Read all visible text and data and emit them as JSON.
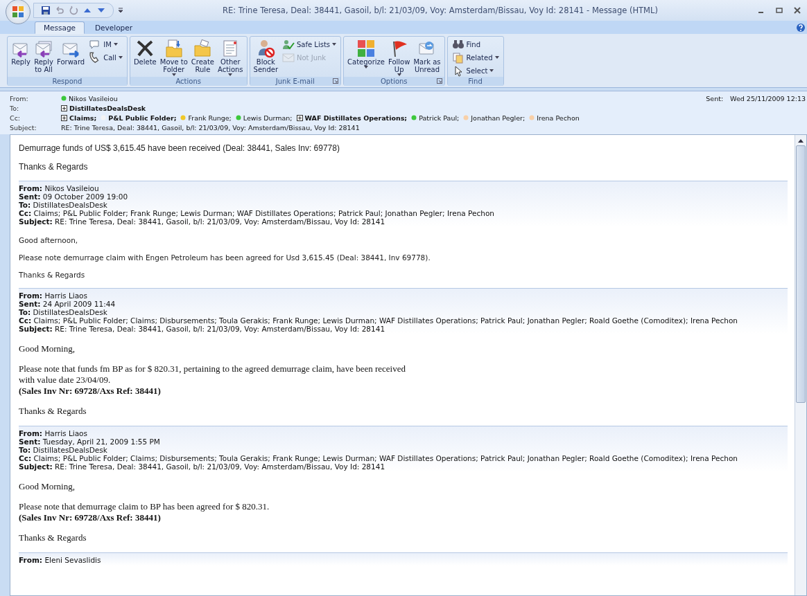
{
  "window": {
    "title": "RE: Trine Teresa, Deal: 38441, Gasoil, b/l: 21/03/09, Voy: Amsterdam/Bissau, Voy Id: 28141  - Message (HTML)"
  },
  "tabs": [
    {
      "label": "Message",
      "selected": true
    },
    {
      "label": "Developer",
      "selected": false
    }
  ],
  "ribbon": [
    {
      "label": "Respond",
      "buttons": [
        {
          "label": "Reply",
          "kind": "large"
        },
        {
          "label": "Reply\nto All",
          "kind": "large"
        },
        {
          "label": "Forward",
          "kind": "large"
        },
        {
          "label": "IM",
          "kind": "small",
          "dropdown": true
        },
        {
          "label": "Call",
          "kind": "small",
          "dropdown": true
        }
      ]
    },
    {
      "label": "Actions",
      "buttons": [
        {
          "label": "Delete",
          "kind": "large"
        },
        {
          "label": "Move to\nFolder",
          "kind": "large",
          "dropdown": true
        },
        {
          "label": "Create\nRule",
          "kind": "large"
        },
        {
          "label": "Other\nActions",
          "kind": "large",
          "dropdown": true
        }
      ]
    },
    {
      "label": "Junk E-mail",
      "launcher": true,
      "buttons": [
        {
          "label": "Block\nSender",
          "kind": "large"
        },
        {
          "label": "Safe Lists",
          "kind": "small",
          "dropdown": true
        },
        {
          "label": "Not Junk",
          "kind": "small",
          "disabled": true
        }
      ]
    },
    {
      "label": "Options",
      "launcher": true,
      "buttons": [
        {
          "label": "Categorize",
          "kind": "large",
          "dropdown": true
        },
        {
          "label": "Follow\nUp",
          "kind": "large",
          "dropdown": true
        },
        {
          "label": "Mark as\nUnread",
          "kind": "large"
        }
      ]
    },
    {
      "label": "Find",
      "buttons": [
        {
          "label": "Find",
          "kind": "small"
        },
        {
          "label": "Related",
          "kind": "small",
          "dropdown": true
        },
        {
          "label": "Select",
          "kind": "small",
          "dropdown": true
        }
      ]
    }
  ],
  "header": {
    "from_label": "From:",
    "from": {
      "name": "Nikos Vasileiou",
      "color": "#3cc83c"
    },
    "sent_label": "Sent:",
    "sent": "Wed 25/11/2009 12:13",
    "to_label": "To:",
    "to": [
      {
        "name": "DistillatesDealsDesk",
        "kind": "group"
      }
    ],
    "cc_label": "Cc:",
    "cc": [
      {
        "name": "Claims;",
        "kind": "group"
      },
      {
        "name": "P&L Public Folder;",
        "kind": "folder",
        "color": "#f4f4f4"
      },
      {
        "name": "Frank Runge;",
        "kind": "person",
        "color": "#f0c828"
      },
      {
        "name": "Lewis Durman;",
        "kind": "person",
        "color": "#3cc83c"
      },
      {
        "name": "WAF Distillates Operations;",
        "kind": "group"
      },
      {
        "name": "Patrick Paul;",
        "kind": "person",
        "color": "#3cc83c"
      },
      {
        "name": "Jonathan Pegler;",
        "kind": "person",
        "color": "#f8d0a8"
      },
      {
        "name": "Irena Pechon",
        "kind": "person",
        "color": "#f8d0a8"
      }
    ],
    "subject_label": "Subject:",
    "subject": "RE: Trine Teresa, Deal: 38441, Gasoil, b/l: 21/03/09, Voy: Amsterdam/Bissau, Voy Id: 28141"
  },
  "body": {
    "paragraphs": [
      "Demurrage funds of US$ 3,615.45 have been received (Deal: 38441, Sales Inv: 69778)",
      "Thanks & Regards"
    ],
    "quoted": [
      {
        "kind": "plain",
        "header": [
          "**From:** Nikos Vasileiou",
          "**Sent:** 09 October 2009 19:00",
          "**To:** DistillatesDealsDesk",
          "**Cc:** Claims; P&L Public Folder; Frank Runge; Lewis Durman; WAF Distillates Operations; Patrick Paul; Jonathan Pegler; Irena Pechon",
          "**Subject:** RE: Trine Teresa, Deal: 38441, Gasoil, b/l: 21/03/09, Voy: Amsterdam/Bissau, Voy Id: 28141"
        ],
        "paragraphs": [
          {
            "text": "Good afternoon,"
          },
          {
            "text": "Please note demurrage claim with Engen Petroleum has been agreed for Usd 3,615.45 (Deal: 38441, Inv 69778)."
          },
          {
            "text": "Thanks & Regards"
          }
        ]
      },
      {
        "kind": "formatted",
        "header": [
          "**From:** Harris Liaos",
          "**Sent:** 24 April 2009 11:44",
          "**To:** DistillatesDealsDesk",
          "**Cc:** Claims; P&L Public Folder; Claims; Disbursements; Toula Gerakis; Frank Runge; Lewis Durman; WAF Distillates Operations; Patrick Paul; Jonathan Pegler; Roald Goethe (Comoditex); Irena Pechon",
          "**Subject:** RE: Trine Teresa, Deal: 38441, Gasoil, b/l: 21/03/09, Voy: Amsterdam/Bissau, Voy Id: 28141"
        ],
        "paragraphs": [
          {
            "text": "Good Morning,"
          },
          {
            "text": "Please note that funds fm BP as for $ 820.31, pertaining to the agreed demurrage claim, have been received\nwith value date 23/04/09."
          },
          {
            "text": "(Sales Inv Nr: 69728/Axs Ref: 38441)",
            "bold": true,
            "joined": true
          },
          {
            "text": "Thanks & Regards"
          }
        ]
      },
      {
        "kind": "formatted",
        "header": [
          "**From:** Harris Liaos",
          "**Sent:** Tuesday, April 21, 2009 1:55 PM",
          "**To:** DistillatesDealsDesk",
          "**Cc:** Claims; P&L Public Folder; Claims; Disbursements; Toula Gerakis; Frank Runge; Lewis Durman; WAF Distillates Operations; Patrick Paul; Jonathan Pegler; Roald Goethe (Comoditex); Irena Pechon",
          "**Subject:** RE: Trine Teresa, Deal: 38441, Gasoil, b/l: 21/03/09, Voy: Amsterdam/Bissau, Voy Id: 28141"
        ],
        "paragraphs": [
          {
            "text": "Good Morning,"
          },
          {
            "text": "Please note that demurrage claim to BP has been agreed for $ 820.31."
          },
          {
            "text": "(Sales Inv Nr: 69728/Axs Ref: 38441)",
            "bold": true,
            "joined": true
          },
          {
            "text": "Thanks & Regards"
          }
        ]
      },
      {
        "header": [
          "**From:** Eleni Sevaslidis"
        ]
      }
    ]
  }
}
